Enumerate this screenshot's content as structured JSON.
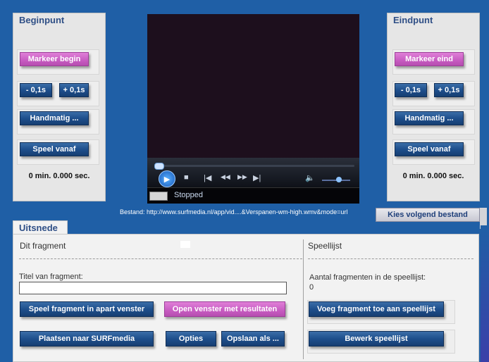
{
  "begin": {
    "title": "Beginpunt",
    "mark_label": "Markeer begin",
    "minus_label": "- 0,1s",
    "plus_label": "+ 0,1s",
    "manual_label": "Handmatig ...",
    "play_from_label": "Speel vanaf",
    "time": "0 min. 0.000 sec."
  },
  "end": {
    "title": "Eindpunt",
    "mark_label": "Markeer eind",
    "minus_label": "- 0,1s",
    "plus_label": "+ 0,1s",
    "manual_label": "Handmatig ...",
    "play_from_label": "Speel vanaf",
    "time": "0 min. 0.000 sec."
  },
  "player": {
    "status": "Stopped"
  },
  "file": {
    "line": "Bestand: http://www.surfmedia.nl/app/vid....&Verspanen-wm-high.wmv&mode=url",
    "next_label": "Kies volgend bestand"
  },
  "uitsnede": {
    "tab_label": "Uitsnede",
    "fragment": {
      "heading": "Dit fragment",
      "title_label": "Titel van fragment:",
      "title_value": "",
      "play_separate_label": "Speel fragment in apart venster",
      "open_results_label": "Open venster met resultaten",
      "post_label": "Plaatsen naar SURFmedia",
      "options_label": "Opties",
      "save_as_label": "Opslaan als ..."
    },
    "playlist": {
      "heading": "Speellijst",
      "count_label": "Aantal fragmenten in de speellijst:",
      "count_value": "0",
      "add_label": "Voeg fragment toe aan speellijst",
      "edit_label": "Bewerk speellijst"
    }
  },
  "colors": {
    "background": "#1f5fa6",
    "button_blue": "#1e4f8c",
    "button_pink": "#c75cc1",
    "panel_title": "#2f4f86"
  }
}
